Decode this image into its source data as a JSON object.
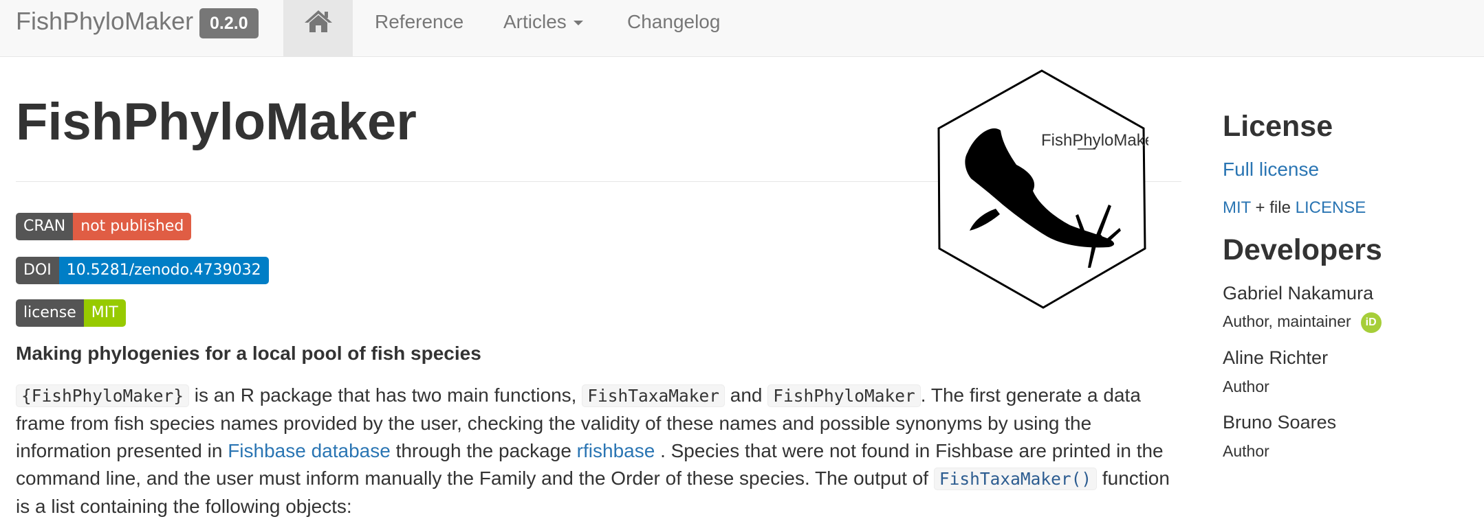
{
  "navbar": {
    "brand": "FishPhyloMaker",
    "version": "0.2.0",
    "home_icon": "home-icon",
    "links": {
      "reference": "Reference",
      "articles": "Articles",
      "changelog": "Changelog"
    }
  },
  "main": {
    "title": "FishPhyloMaker",
    "logo_text": "FishPhyloMaker",
    "badges": {
      "cran": {
        "label": "CRAN",
        "value": "not published",
        "color": "#e05d44"
      },
      "doi": {
        "label": "DOI",
        "value": "10.5281/zenodo.4739032",
        "color": "#007ec6"
      },
      "license": {
        "label": "license",
        "value": "MIT",
        "color": "#97ca00"
      }
    },
    "lede": "Making phylogenies for a local pool of fish species",
    "paragraph": {
      "code_pkg": "{FishPhyloMaker}",
      "t1": " is an R package that has two main functions, ",
      "code_taxa": "FishTaxaMaker",
      "t2": " and ",
      "code_phylo": "FishPhyloMaker",
      "t3": ". The first generate a data frame from fish species names provided by the user, checking the validity of these names and possible synonyms by using the information presented in ",
      "link_fishbase": "Fishbase database",
      "t4": " through the package ",
      "link_rfishbase": "rfishbase",
      "t5": " . Species that were not found in Fishbase are printed in the command line, and the user must inform manually the Family and the Order of these species. The output of ",
      "code_fn": "FishTaxaMaker()",
      "t6": " function is a list containing the following objects:"
    }
  },
  "sidebar": {
    "license_heading": "License",
    "full_license": "Full license",
    "mit": "MIT",
    "plus_file": " + file ",
    "license_file": "LICENSE",
    "developers_heading": "Developers",
    "developers": [
      {
        "name": "Gabriel Nakamura",
        "role": "Author, maintainer",
        "orcid": "iD"
      },
      {
        "name": "Aline Richter",
        "role": "Author"
      },
      {
        "name": "Bruno Soares",
        "role": "Author"
      }
    ]
  },
  "colors": {
    "link": "#2a75b3",
    "orcid": "#a6ce39",
    "navbar_bg": "#f8f8f8"
  }
}
